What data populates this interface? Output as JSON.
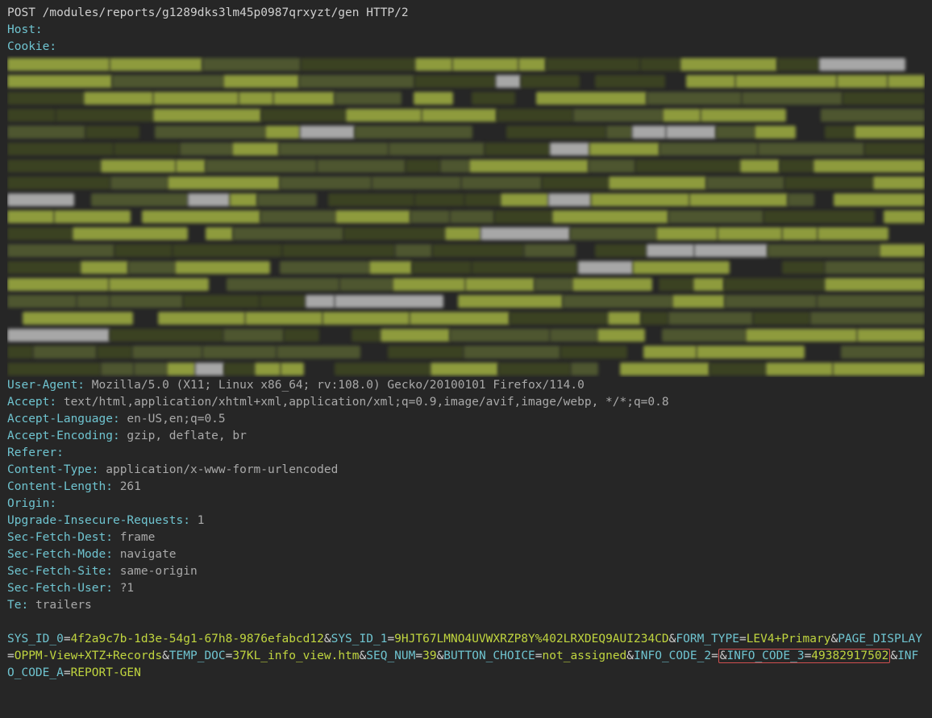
{
  "request": {
    "method": "POST",
    "path": "/modules/reports/g1289dks3lm45p0987qrxyzt/gen",
    "protocol": "HTTP/2"
  },
  "headers": {
    "host_name": "Host:",
    "host_val": "",
    "cookie_name": "Cookie:",
    "cookie_val": "",
    "ua_name": "User-Agent:",
    "ua_val": "Mozilla/5.0 (X11; Linux x86_64; rv:108.0) Gecko/20100101 Firefox/114.0",
    "accept_name": "Accept:",
    "accept_val": "text/html,application/xhtml+xml,application/xml;q=0.9,image/avif,image/webp, */*;q=0.8",
    "acclang_name": "Accept-Language:",
    "acclang_val": "en-US,en;q=0.5",
    "accenc_name": "Accept-Encoding:",
    "accenc_val": "gzip, deflate, br",
    "referer_name": "Referer:",
    "referer_val": "",
    "ctype_name": "Content-Type:",
    "ctype_val": "application/x-www-form-urlencoded",
    "clen_name": "Content-Length:",
    "clen_val": "261",
    "origin_name": "Origin:",
    "origin_val": "",
    "upg_name": "Upgrade-Insecure-Requests:",
    "upg_val": "1",
    "sfd_name": "Sec-Fetch-Dest:",
    "sfd_val": "frame",
    "sfm_name": "Sec-Fetch-Mode:",
    "sfm_val": "navigate",
    "sfs_name": "Sec-Fetch-Site:",
    "sfs_val": "same-origin",
    "sfu_name": "Sec-Fetch-User:",
    "sfu_val": "?1",
    "te_name": "Te:",
    "te_val": "trailers"
  },
  "body": {
    "params": [
      {
        "k": "SYS_ID_0",
        "v": "4f2a9c7b-1d3e-54g1-67h8-9876efabcd12"
      },
      {
        "k": "SYS_ID_1",
        "v": "9HJT67LMNO4UVWXRZP8Y%402LRXDEQ9AUI234CD"
      },
      {
        "k": "FORM_TYPE",
        "v": "LEV4+Primary"
      },
      {
        "k": "PAGE_DISPLAY",
        "v": "OPPM-View+XTZ+Records"
      },
      {
        "k": "TEMP_DOC",
        "v": "37KL_info_view.htm"
      },
      {
        "k": "SEQ_NUM",
        "v": "39"
      },
      {
        "k": "BUTTON_CHOICE",
        "v": "not_assigned"
      },
      {
        "k": "INFO_CODE_2",
        "v": ""
      },
      {
        "k": "INFO_CODE_3",
        "v": "49382917502",
        "hl": true
      },
      {
        "k": "INFO_CODE_A",
        "v": "REPORT-GEN"
      }
    ]
  }
}
